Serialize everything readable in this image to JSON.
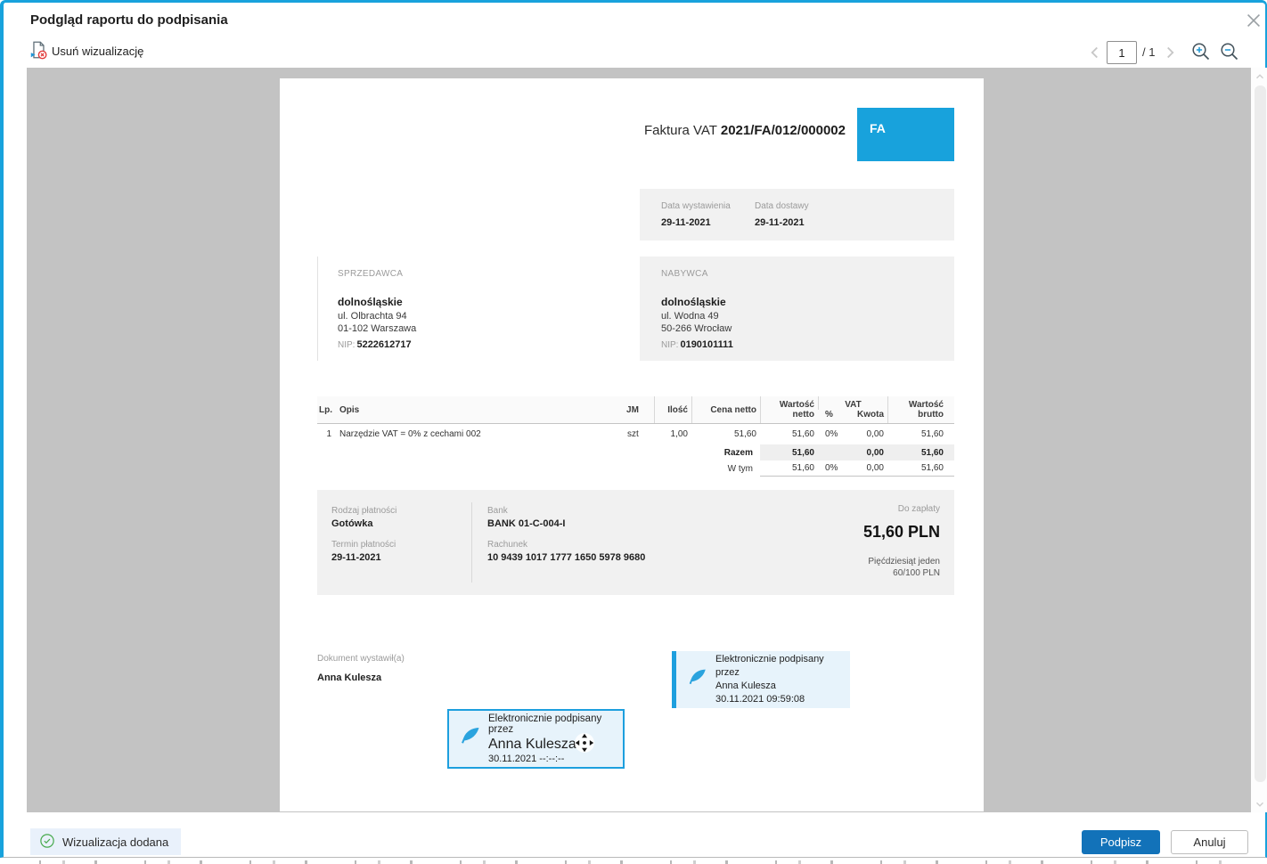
{
  "dialog": {
    "title": "Podgląd raportu do podpisania"
  },
  "toolbar": {
    "remove_visualization": "Usuń wizualizację",
    "page_value": "1",
    "page_total": "/ 1"
  },
  "invoice": {
    "header": {
      "title": "Faktura VAT ",
      "number": "2021/FA/012/000002",
      "badge": "FA"
    },
    "dates": {
      "issue_label": "Data wystawienia",
      "issue_value": "29-11-2021",
      "delivery_label": "Data dostawy",
      "delivery_value": "29-11-2021"
    },
    "seller": {
      "section_label": "SPRZEDAWCA",
      "name": "dolnośląskie",
      "address1": "ul. Olbrachta 94",
      "address2": "01-102 Warszawa",
      "nip_label": "NIP:",
      "nip_value": "5222612717"
    },
    "buyer": {
      "section_label": "NABYWCA",
      "name": "dolnośląskie",
      "address1": "ul. Wodna 49",
      "address2": "50-266 Wrocław",
      "nip_label": "NIP:",
      "nip_value": "0190101111"
    },
    "table": {
      "h_lp": "Lp.",
      "h_opis": "Opis",
      "h_jm": "JM",
      "h_ilosc": "Ilość",
      "h_cena_netto": "Cena netto",
      "h_wartosc_netto": "Wartość\nnetto",
      "h_vat": "VAT",
      "h_pct": "%",
      "h_kwota": "Kwota",
      "h_wartosc_brutto": "Wartość\nbrutto",
      "row": {
        "lp": "1",
        "opis": "Narzędzie VAT = 0% z cechami 002",
        "jm": "szt",
        "ilosc": "1,00",
        "cena_netto": "51,60",
        "wartosc_netto": "51,60",
        "pct": "0%",
        "kwota": "0,00",
        "brutto": "51,60"
      },
      "razem": {
        "label": "Razem",
        "netto": "51,60",
        "pct": "",
        "kwota": "0,00",
        "brutto": "51,60"
      },
      "wtym": {
        "label": "W tym",
        "netto": "51,60",
        "pct": "0%",
        "kwota": "0,00",
        "brutto": "51,60"
      }
    },
    "payment": {
      "type_label": "Rodzaj płatności",
      "type_value": "Gotówka",
      "term_label": "Termin płatności",
      "term_value": "29-11-2021",
      "bank_label": "Bank",
      "bank_value": "BANK 01-C-004-I",
      "account_label": "Rachunek",
      "account_value": "10 9439 1017 1777 1650 5978 9680",
      "due_label": "Do zapłaty",
      "due_value": "51,60 PLN",
      "words_line1": "Pięćdziesiąt jeden",
      "words_line2": "60/100 PLN"
    },
    "issuer": {
      "label": "Dokument wystawił(a)",
      "name": "Anna Kulesza"
    },
    "stamp_placed": {
      "line1": "Elektronicznie podpisany przez",
      "line2": "Anna Kulesza",
      "line3": "30.11.2021 09:59:08"
    },
    "stamp_dragging": {
      "line1": "Elektronicznie podpisany przez",
      "line2": "Anna Kulesza",
      "line3": "30.11.2021 --:--:--"
    }
  },
  "footer": {
    "status": "Wizualizacja dodana",
    "sign": "Podpisz",
    "cancel": "Anuluj"
  },
  "colors": {
    "accent": "#18a2dc",
    "primary_button": "#1272b9",
    "status_green": "#46a94c"
  }
}
